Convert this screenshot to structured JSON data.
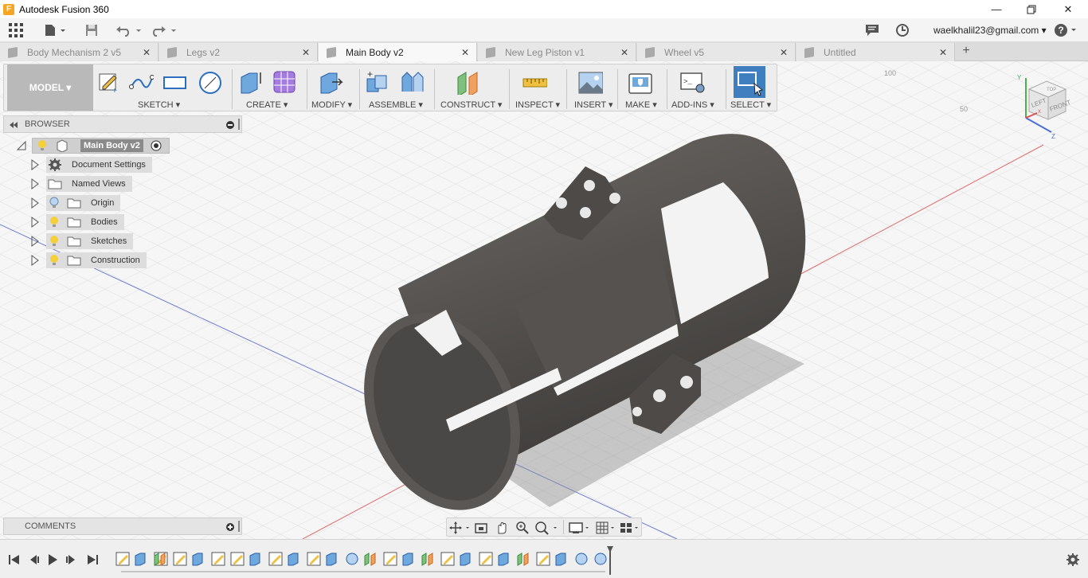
{
  "window": {
    "title": "Autodesk Fusion 360",
    "app_icon": "F"
  },
  "appbar": {
    "user": "waelkhalil23@gmail.com ▾"
  },
  "tabs": [
    {
      "label": "Body Mechanism 2 v5",
      "active": false
    },
    {
      "label": "Legs v2",
      "active": false
    },
    {
      "label": "Main Body v2",
      "active": true
    },
    {
      "label": "New Leg Piston v1",
      "active": false
    },
    {
      "label": "Wheel v5",
      "active": false
    },
    {
      "label": "Untitled",
      "active": false
    }
  ],
  "toolbar": {
    "workspace": "MODEL ▾",
    "groups": {
      "sketch": "SKETCH ▾",
      "create": "CREATE ▾",
      "modify": "MODIFY ▾",
      "assemble": "ASSEMBLE ▾",
      "construct": "CONSTRUCT ▾",
      "inspect": "INSPECT ▾",
      "insert": "INSERT ▾",
      "make": "MAKE ▾",
      "addins": "ADD-INS ▾",
      "select": "SELECT ▾"
    }
  },
  "browser": {
    "title": "BROWSER",
    "root": "Main Body v2",
    "items": [
      "Document Settings",
      "Named Views",
      "Origin",
      "Bodies",
      "Sketches",
      "Construction"
    ]
  },
  "comments": {
    "title": "COMMENTS"
  },
  "viewcube": {
    "top": "TOP",
    "left": "LEFT",
    "front": "FRONT",
    "x": "X",
    "y": "Y",
    "z": "Z"
  },
  "grid_labels": {
    "a": "100",
    "b": "50"
  },
  "colors": {
    "accent": "#3c7bbd",
    "model": "#55524f",
    "selected": "#3f7fbf"
  }
}
